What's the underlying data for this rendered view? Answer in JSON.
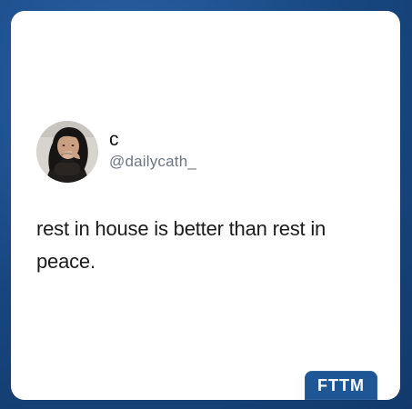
{
  "tweet": {
    "display_name": "c",
    "handle": "@dailycath_",
    "text": "rest in house is better than rest in peace."
  },
  "brand": {
    "label": "FTTM"
  },
  "colors": {
    "background": "#1b4d8c",
    "card": "#ffffff",
    "handle": "#6d7680",
    "brand": "#1f5696"
  }
}
